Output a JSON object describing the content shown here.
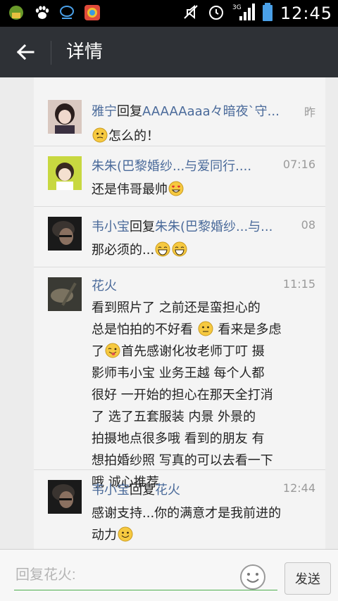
{
  "status_bar": {
    "time": "12:45",
    "network": "3G",
    "left_icons": [
      "app-icon",
      "paw-icon",
      "messenger-icon",
      "browser-icon"
    ],
    "right_icons": [
      "mute-icon",
      "alarm-icon",
      "signal-icon",
      "battery-icon"
    ]
  },
  "nav": {
    "title": "详情",
    "back_icon": "arrow-left-icon"
  },
  "comments": [
    {
      "name": "雅宁",
      "reply_word": "回复",
      "target": "AAAAAaaa々暗夜`守...",
      "time": "昨",
      "text": "怎么的！",
      "emoji_before": "thinking-emoji"
    },
    {
      "name": "朱朱(巴黎婚纱...与爱同行....",
      "reply_word": "",
      "target": "",
      "time": "07:16",
      "text": "还是伟哥最帅",
      "emoji_after": "heart-eyes-emoji"
    },
    {
      "name": "韦小宝",
      "reply_word": "回复",
      "target": "朱朱(巴黎婚纱...与...",
      "time": "08",
      "text": "那必须的...",
      "emoji_after": "grin-emoji"
    },
    {
      "name": "花火",
      "reply_word": "",
      "target": "",
      "time": "11:15",
      "text_lines": [
        "看到照片了  之前还是蛮担心的",
        "总是怕拍的不好看",
        "看来是多虑",
        "了",
        "首先感谢化妆老师丁叮  摄",
        "影师韦小宝  业务王越  每个人都",
        "很好  一开始的担心在那天全打消",
        "了  选了五套服装  内景 外景的",
        "拍摄地点很多哦  看到的朋友  有",
        "想拍婚纱照  写真的可以去看一下",
        "哦  诚心推荐"
      ]
    },
    {
      "name": "韦小宝",
      "reply_word": "回复",
      "target": "花火",
      "time": "12:44",
      "text_lines": [
        "感谢支持...你的满意才是我前进的",
        "动力"
      ],
      "emoji_after": "smile-emoji"
    }
  ],
  "input": {
    "placeholder": "回复花火:",
    "send_label": "发送"
  },
  "colors": {
    "nav_bg": "#2e3136",
    "name_blue": "#4a6a9a",
    "accent_green": "#4cae4c"
  }
}
